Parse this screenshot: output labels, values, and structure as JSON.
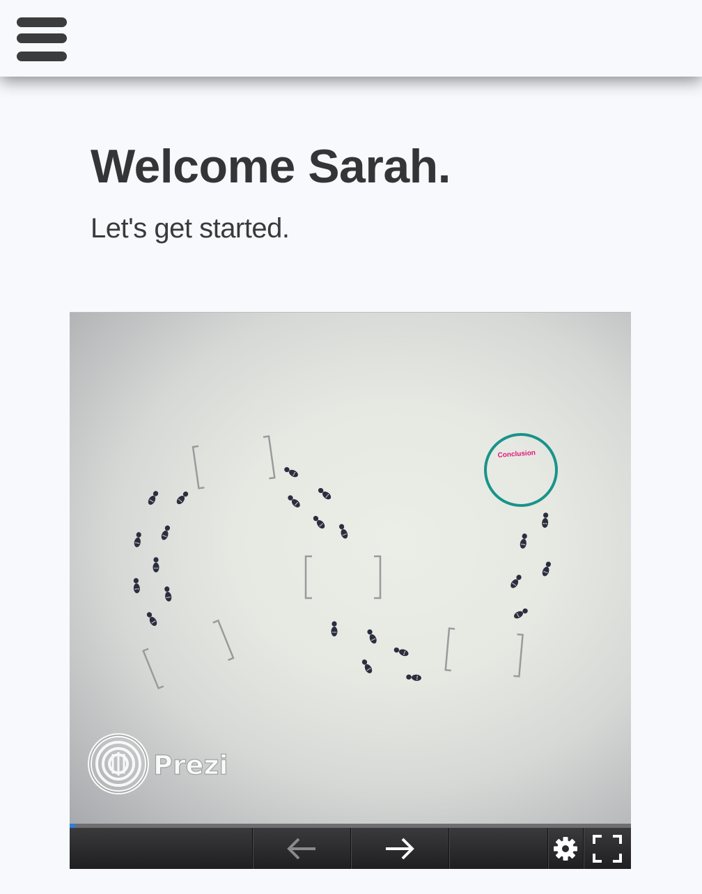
{
  "header": {
    "menu_icon": "hamburger-menu-icon"
  },
  "main": {
    "title": "Welcome Sarah.",
    "subtitle": "Let's get started."
  },
  "presentation": {
    "logo_text": "Prezi",
    "conclusion_label": "Conclusion",
    "progress": 0.01,
    "colors": {
      "circle": "#19938a",
      "conclusion_text": "#e2167f",
      "progress": "#2f7dd8"
    },
    "controls": {
      "prev_icon": "arrow-left-icon",
      "next_icon": "arrow-right-icon",
      "settings_icon": "gear-icon",
      "fullscreen_icon": "fullscreen-icon"
    }
  }
}
